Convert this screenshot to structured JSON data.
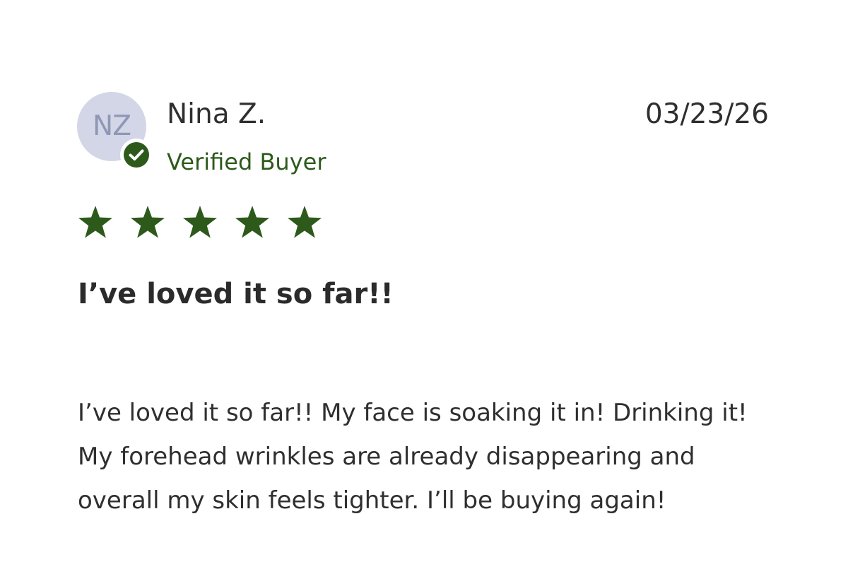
{
  "review": {
    "reviewer": {
      "initials": "NZ",
      "name": "Nina Z.",
      "verified_label": "Verified Buyer"
    },
    "date": "03/23/26",
    "rating": {
      "value": 5,
      "max": 5
    },
    "title": "I’ve loved it so far!!",
    "body": "I’ve loved it so far!! My face is soaking it in! Drinking it! My forehead wrinkles are already disappearing and overall my skin feels tighter. I’ll be buying again!"
  },
  "colors": {
    "accent_green": "#2d5a1b",
    "avatar_bg": "#d3d6e6",
    "avatar_text": "#8f97b6",
    "text": "#2f2f2f"
  },
  "icons": {
    "verified": "check-circle-icon",
    "rating": "star-icon"
  }
}
